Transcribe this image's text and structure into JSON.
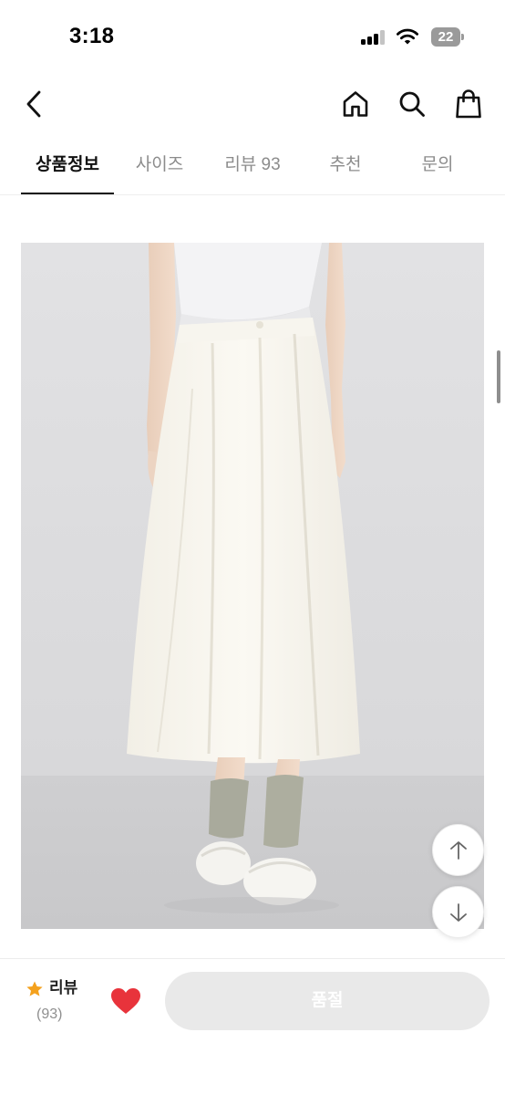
{
  "status_bar": {
    "time": "3:18",
    "battery_level": "22",
    "icons": [
      "signal-icon",
      "wifi-icon",
      "battery-icon"
    ]
  },
  "header": {
    "icons": [
      "back-arrow-icon",
      "home-icon",
      "search-icon",
      "shopping-bag-icon"
    ]
  },
  "tabs": [
    {
      "label": "상품정보",
      "active": true
    },
    {
      "label": "사이즈",
      "active": false
    },
    {
      "label": "리뷰 93",
      "active": false
    },
    {
      "label": "추천",
      "active": false
    },
    {
      "label": "문의",
      "active": false
    }
  ],
  "floating_buttons": {
    "icons": [
      "arrow-up-icon",
      "arrow-down-icon"
    ]
  },
  "bottom_bar": {
    "review_label": "리뷰",
    "review_count": "(93)",
    "soldout_label": "품절",
    "colors": {
      "star": "#f4a11d",
      "heart": "#e8333b",
      "soldout_bg": "#e9e9e9"
    }
  }
}
